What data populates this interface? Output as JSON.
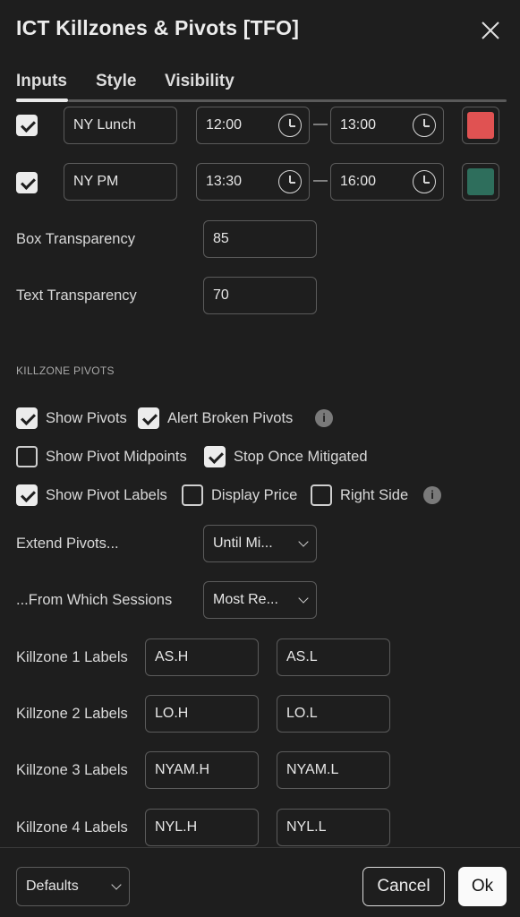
{
  "dialog": {
    "title": "ICT Killzones & Pivots [TFO]"
  },
  "tabs": [
    "Inputs",
    "Style",
    "Visibility"
  ],
  "sessions": [
    {
      "enabled": true,
      "name": "NY Lunch",
      "start": "12:00",
      "end": "13:00",
      "color": "#e05252",
      "separator": "—"
    },
    {
      "enabled": true,
      "name": "NY PM",
      "start": "13:30",
      "end": "16:00",
      "color": "#2e6e5c",
      "separator": "—"
    }
  ],
  "box_transparency": {
    "label": "Box Transparency",
    "value": "85"
  },
  "text_transparency": {
    "label": "Text Transparency",
    "value": "70"
  },
  "pivots": {
    "section_title": "KILLZONE PIVOTS",
    "show_pivots": {
      "label": "Show Pivots",
      "checked": true
    },
    "alert_broken": {
      "label": "Alert Broken Pivots",
      "checked": true
    },
    "show_midpoints": {
      "label": "Show Pivot Midpoints",
      "checked": false
    },
    "stop_mitigated": {
      "label": "Stop Once Mitigated",
      "checked": true
    },
    "show_labels": {
      "label": "Show Pivot Labels",
      "checked": true
    },
    "display_price": {
      "label": "Display Price",
      "checked": false
    },
    "right_side": {
      "label": "Right Side",
      "checked": false
    },
    "extend": {
      "label": "Extend Pivots...",
      "value": "Until Mi..."
    },
    "from_sessions": {
      "label": "...From Which Sessions",
      "value": "Most Re..."
    }
  },
  "killzone_labels": [
    {
      "label": "Killzone 1 Labels",
      "high": "AS.H",
      "low": "AS.L"
    },
    {
      "label": "Killzone 2 Labels",
      "high": "LO.H",
      "low": "LO.L"
    },
    {
      "label": "Killzone 3 Labels",
      "high": "NYAM.H",
      "low": "NYAM.L"
    },
    {
      "label": "Killzone 4 Labels",
      "high": "NYL.H",
      "low": "NYL.L"
    }
  ],
  "footer": {
    "defaults": "Defaults",
    "cancel": "Cancel",
    "ok": "Ok"
  },
  "icons": {
    "info": "i"
  }
}
